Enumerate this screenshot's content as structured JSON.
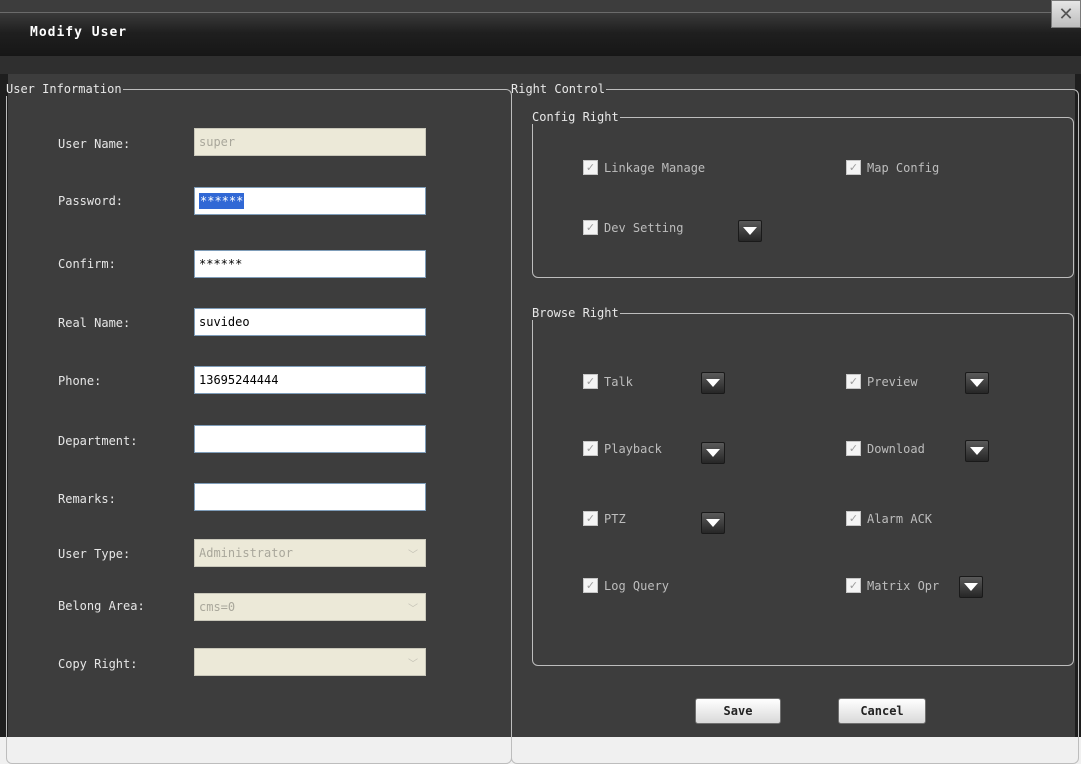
{
  "window": {
    "title": "Modify User",
    "close_glyph": "✕"
  },
  "user_info": {
    "legend": "User Information",
    "fields": [
      {
        "label": "User Name:",
        "value": "super",
        "state": "disabled"
      },
      {
        "label": "Password:",
        "value": "******",
        "state": "selected"
      },
      {
        "label": "Confirm:",
        "value": "******",
        "state": "normal"
      },
      {
        "label": "Real Name:",
        "value": "suvideo",
        "state": "normal"
      },
      {
        "label": "Phone:",
        "value": "13695244444",
        "state": "normal"
      },
      {
        "label": "Department:",
        "value": "",
        "state": "normal"
      },
      {
        "label": "Remarks:",
        "value": "",
        "state": "normal"
      },
      {
        "label": "User Type:",
        "value": "Administrator",
        "state": "disabled-combo"
      },
      {
        "label": "Belong Area:",
        "value": "cms=0",
        "state": "disabled-combo"
      },
      {
        "label": "Copy Right:",
        "value": "",
        "state": "disabled-combo"
      }
    ]
  },
  "right_control": {
    "legend": "Right Control",
    "config_right": {
      "legend": "Config Right",
      "items": [
        {
          "label": "Linkage Manage",
          "checked": true,
          "has_dropdown": false
        },
        {
          "label": "Map Config",
          "checked": true,
          "has_dropdown": false
        },
        {
          "label": "Dev Setting",
          "checked": true,
          "has_dropdown": true
        }
      ]
    },
    "browse_right": {
      "legend": "Browse Right",
      "items": [
        {
          "label": "Talk",
          "checked": true,
          "has_dropdown": true
        },
        {
          "label": "Preview",
          "checked": true,
          "has_dropdown": true
        },
        {
          "label": "Playback",
          "checked": true,
          "has_dropdown": true
        },
        {
          "label": "Download",
          "checked": true,
          "has_dropdown": true
        },
        {
          "label": "PTZ",
          "checked": true,
          "has_dropdown": true
        },
        {
          "label": "Alarm ACK",
          "checked": true,
          "has_dropdown": false
        },
        {
          "label": "Log Query",
          "checked": true,
          "has_dropdown": false
        },
        {
          "label": "Matrix Opr",
          "checked": true,
          "has_dropdown": true
        }
      ]
    }
  },
  "buttons": {
    "save": "Save",
    "cancel": "Cancel"
  },
  "icons": {
    "check": "✓",
    "combo_arrow": "chevron-down-icon",
    "dropdown_arrow": "triangle-down-icon"
  },
  "colors": {
    "window_bg": "#3d3d3d",
    "titlebar": "#1f1f1f",
    "selection": "#3168d5",
    "disabled_field": "#ece9d8"
  }
}
